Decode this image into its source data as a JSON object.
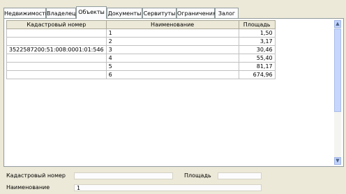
{
  "tabs": [
    {
      "label": "Недвижимость"
    },
    {
      "label": "Владелец"
    },
    {
      "label": "Объекты"
    },
    {
      "label": "Документы"
    },
    {
      "label": "Сервитуты"
    },
    {
      "label": "Ограничения"
    },
    {
      "label": "Залог"
    }
  ],
  "active_tab": "Объекты",
  "table": {
    "headers": [
      "Кадастровый номер",
      "Наименование",
      "Площадь"
    ],
    "rows": [
      {
        "cad": "",
        "name": "1",
        "area": "1,50"
      },
      {
        "cad": "",
        "name": "2",
        "area": "3,17"
      },
      {
        "cad": "3522587200:51:008:0001:01:546",
        "name": "3",
        "area": "30,46"
      },
      {
        "cad": "",
        "name": "4",
        "area": "55,40"
      },
      {
        "cad": "",
        "name": "5",
        "area": "81,17"
      },
      {
        "cad": "",
        "name": "6",
        "area": "674,96"
      }
    ]
  },
  "form": {
    "cad_label": "Кадастровый номер",
    "cad_value": "",
    "area_label": "Площадь",
    "area_value": "",
    "name_label": "Наименование",
    "name_value": "1"
  },
  "colors": {
    "window_bg": "#ece9d8",
    "scrollbar": "#c1d3fb"
  }
}
